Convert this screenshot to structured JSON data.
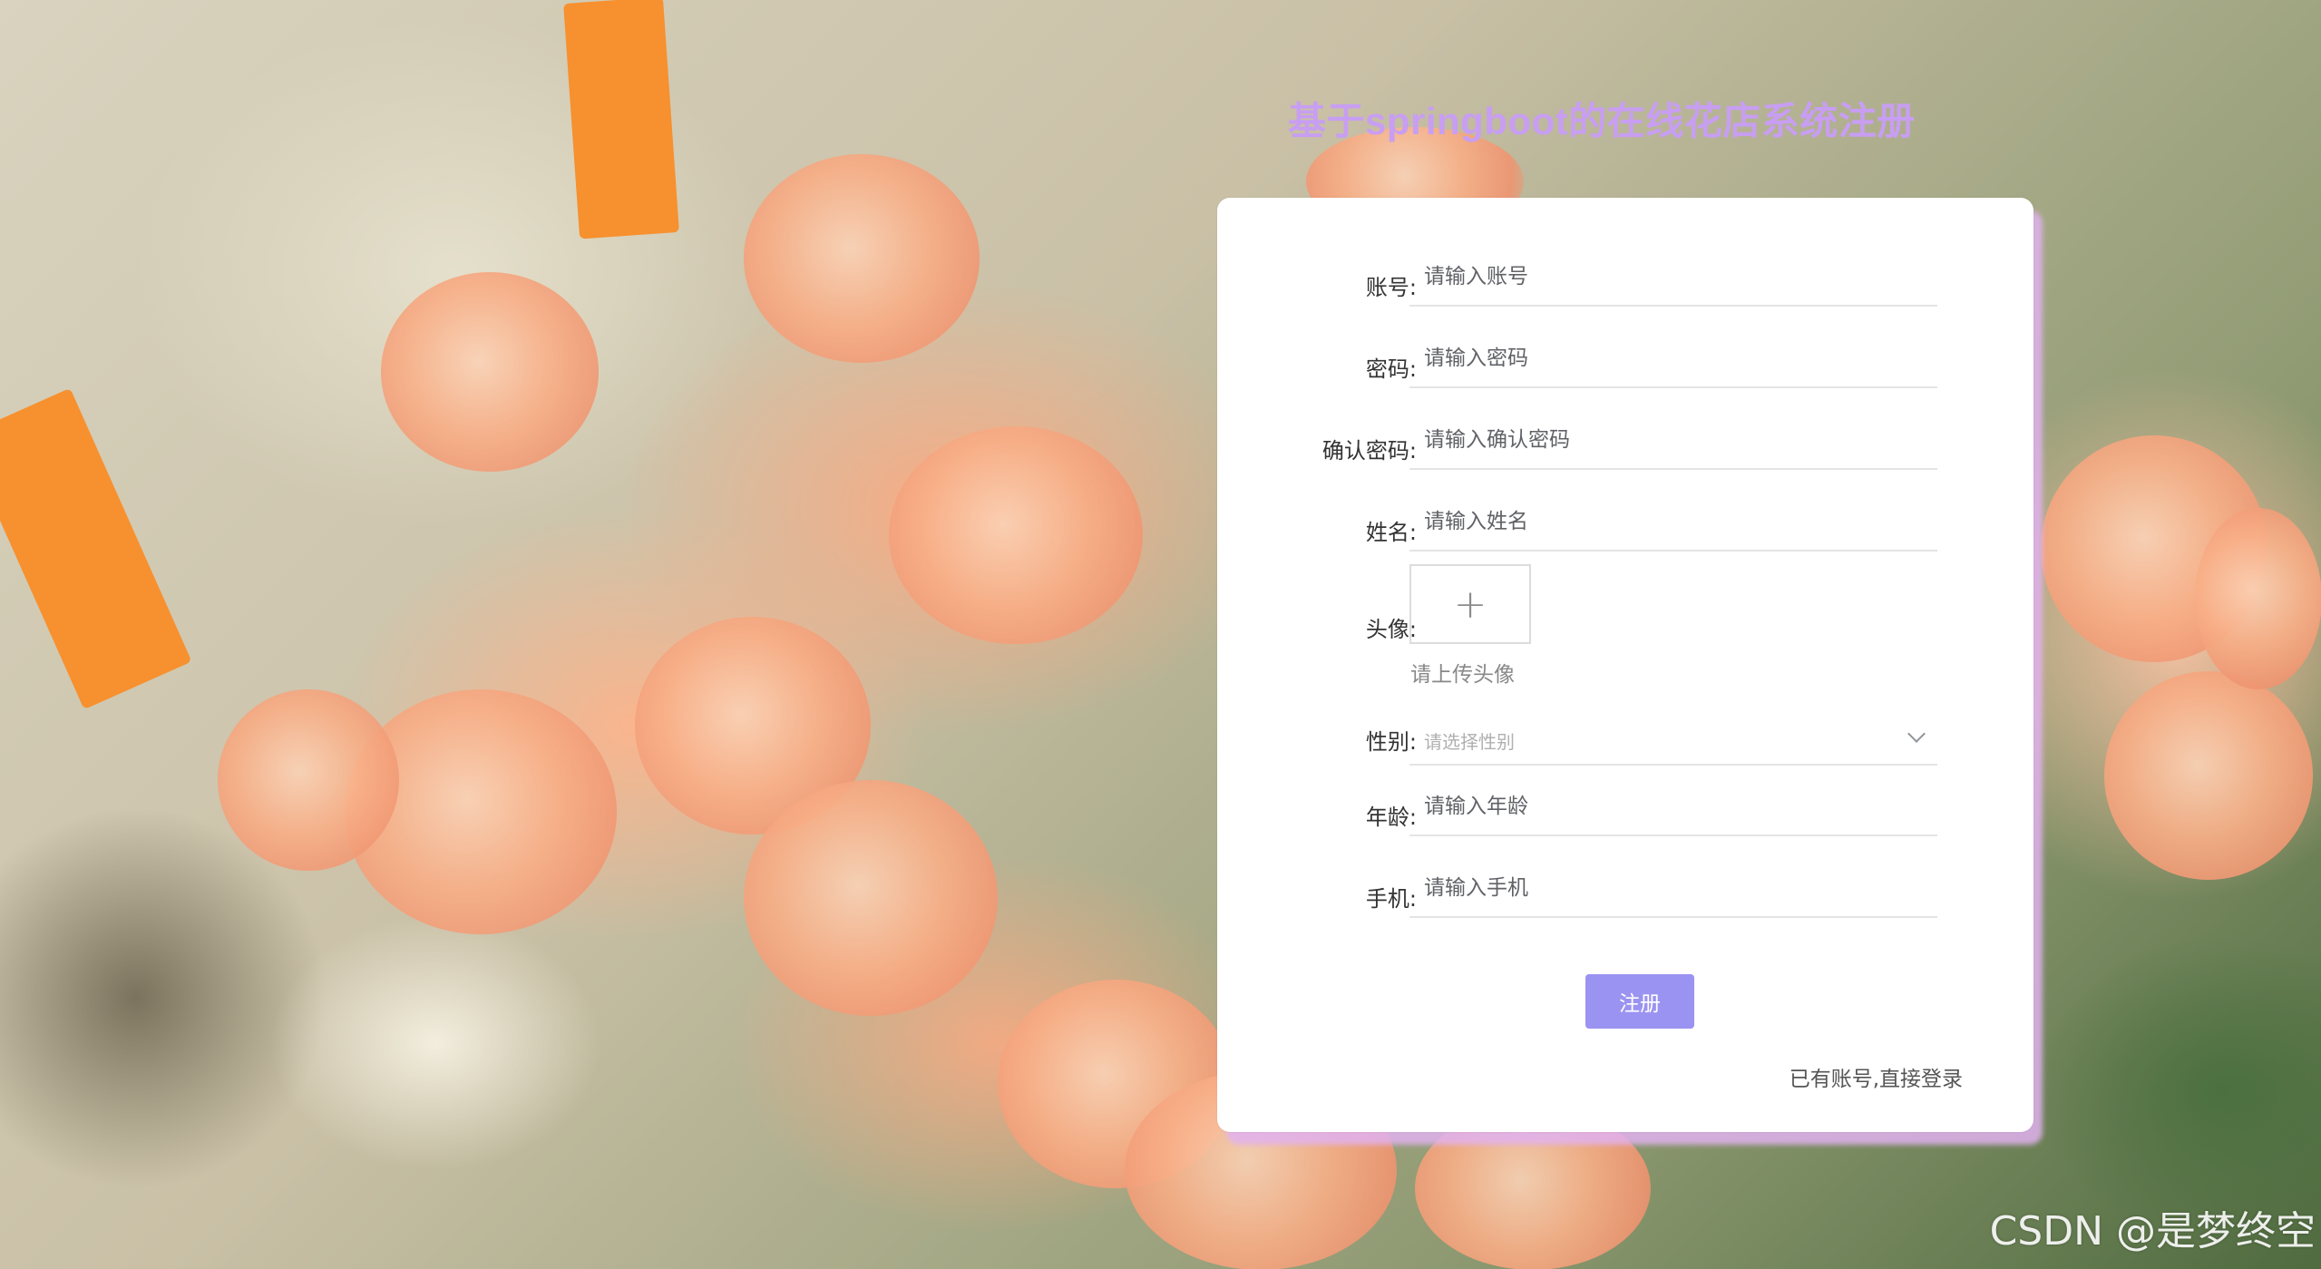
{
  "title": "基于springboot的在线花店系统注册",
  "form": {
    "account": {
      "label": "账号:",
      "placeholder": "请输入账号"
    },
    "password": {
      "label": "密码:",
      "placeholder": "请输入密码"
    },
    "confirm_password": {
      "label": "确认密码:",
      "placeholder": "请输入确认密码"
    },
    "name": {
      "label": "姓名:",
      "placeholder": "请输入姓名"
    },
    "avatar": {
      "label": "头像:",
      "upload_icon": "+",
      "hint": "请上传头像"
    },
    "gender": {
      "label": "性别:",
      "placeholder": "请选择性别"
    },
    "age": {
      "label": "年龄:",
      "placeholder": "请输入年龄"
    },
    "phone": {
      "label": "手机:",
      "placeholder": "请输入手机"
    },
    "submit_label": "注册",
    "login_link": "已有账号,直接登录"
  },
  "watermark": "CSDN @是梦终空",
  "colors": {
    "title": "#c89ef2",
    "button": "#9b93f1",
    "card_shadow": "#e1b2f0"
  }
}
